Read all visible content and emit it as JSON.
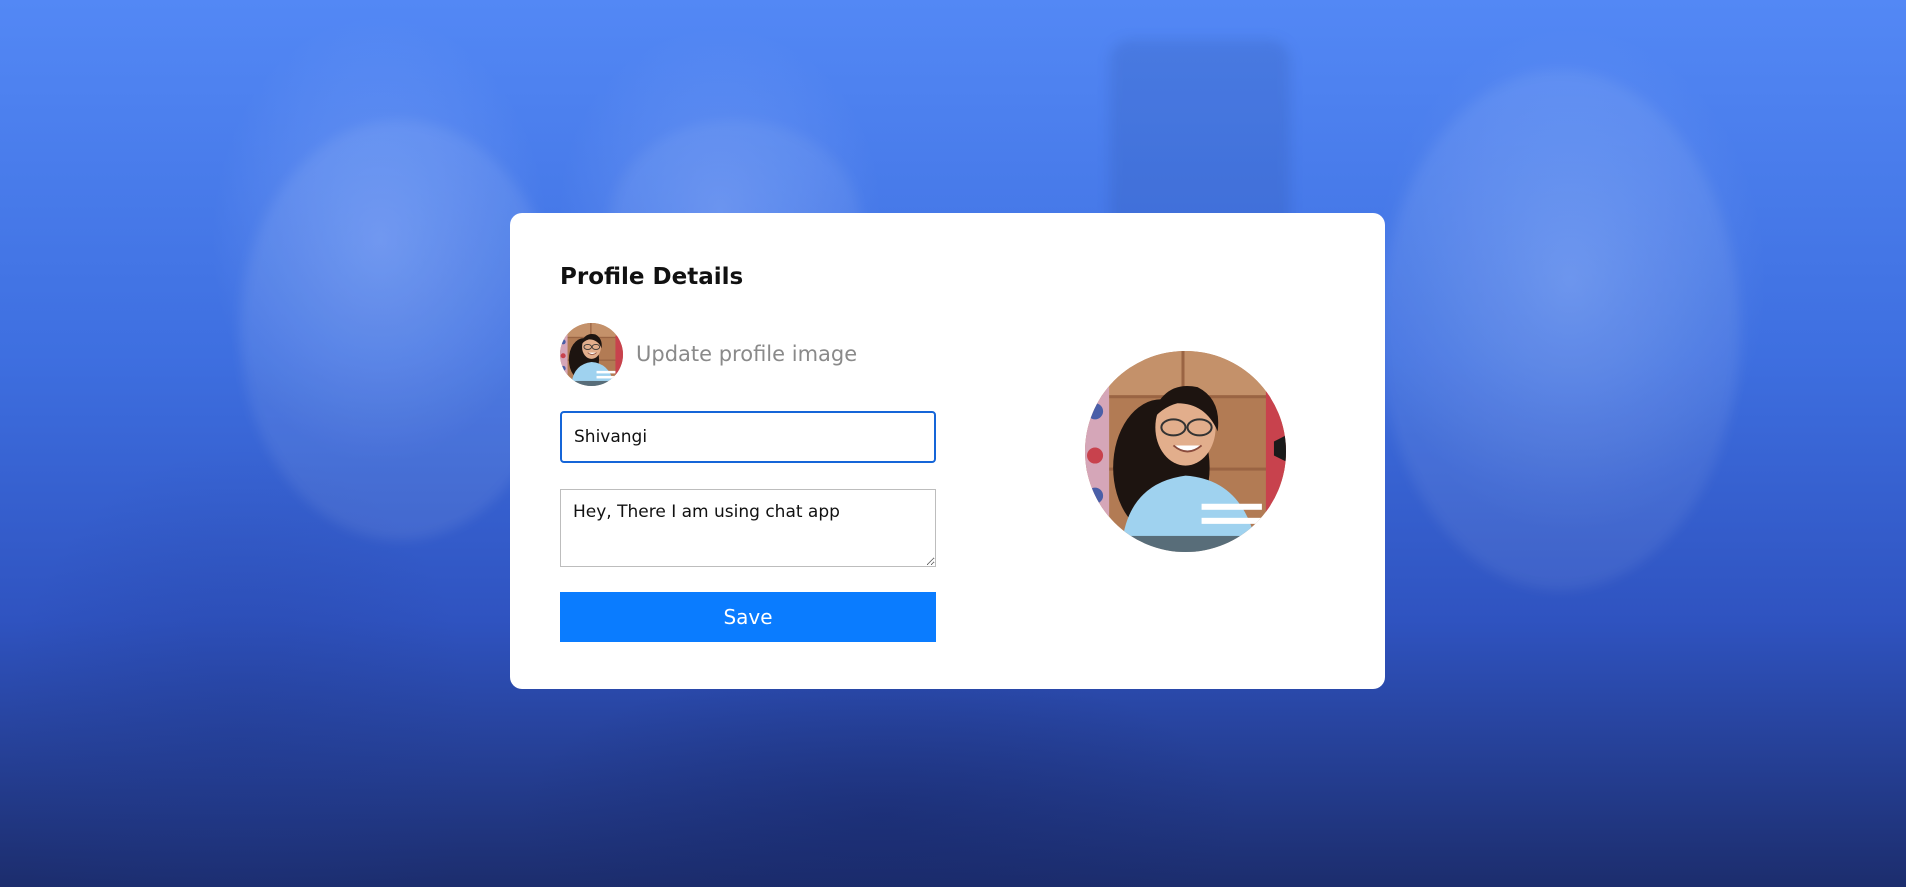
{
  "page": {
    "title": "Profile Details"
  },
  "profile": {
    "upload_label": "Update profile image",
    "name_value": "Shivangi",
    "bio_value": "Hey, There I am using chat app",
    "save_label": "Save"
  },
  "colors": {
    "accent": "#0a7cff",
    "input_focus_border": "#1565d8",
    "background_top": "#5388f5",
    "background_bottom": "#1c2d6d"
  },
  "icons": {
    "avatar_small": "profile-photo",
    "avatar_large": "profile-photo"
  }
}
